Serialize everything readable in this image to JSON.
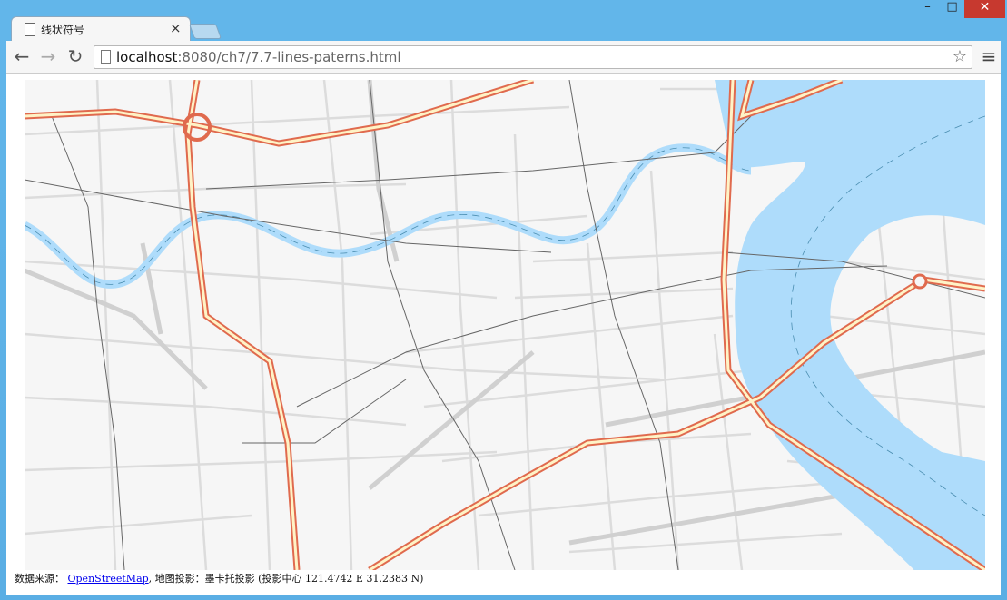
{
  "tab": {
    "title": "线状符号",
    "close": "×"
  },
  "window": {
    "minimize": "–",
    "maximize": "□",
    "close": "✕"
  },
  "nav": {
    "back": "←",
    "forward": "→",
    "reload": "↻",
    "star": "☆",
    "menu": "≡"
  },
  "address": {
    "host": "localhost",
    "path": ":8080/ch7/7.7-lines-paterns.html"
  },
  "attribution": {
    "source_label": "数据来源：",
    "source_link": "OpenStreetMap",
    "projection_text": ", 地图投影：墨卡托投影 (投影中心 121.4742 E 31.2383 N)"
  },
  "map_colors": {
    "land": "#f6f6f6",
    "water": "#aedcfb",
    "road_casing": "#e06a4e",
    "road_fill": "#fff3c6",
    "minor_road": "#dadada",
    "rail": "#555555",
    "ferry": "#4a8db0"
  },
  "icons": [
    "page-icon",
    "close-icon",
    "back-icon",
    "forward-icon",
    "reload-icon",
    "star-icon",
    "menu-icon"
  ]
}
